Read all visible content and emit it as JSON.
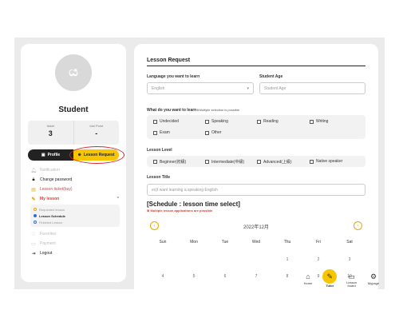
{
  "profile": {
    "avatar_text": "ය",
    "name": "Student",
    "stats": [
      {
        "label": "ticket",
        "value": "3"
      },
      {
        "label": "Idol Point",
        "value": "-"
      }
    ],
    "tabs": {
      "profile": "Profile",
      "lesson_request": "Lesson Request"
    }
  },
  "menu": {
    "notification": "Notification",
    "change_password": "Change password",
    "lesson_ticket": "Lesson ticket(buy)",
    "my_lesson": "My lesson",
    "sub": [
      "Requested lesson",
      "Lesson Schedule",
      "Finished Lesson"
    ],
    "favorites": "Favorites",
    "payment": "Payment",
    "logout": "Logout"
  },
  "form": {
    "title": "Lesson Request",
    "language_label": "Language you want to learn",
    "language_value": "English",
    "age_label": "Student Age",
    "age_placeholder": "Student Age",
    "learn_label": "What do you want to learn",
    "learn_note": "※Multiple selection is possible",
    "learn_options": [
      "Undecided",
      "Speaking",
      "Reading",
      "Writing",
      "Exam",
      "Other"
    ],
    "level_label": "Lesson Level",
    "level_options": [
      "Beginner(初級)",
      "Intermediate(中級)",
      "Advanced(上級)",
      "Native speaker"
    ],
    "lesson_title_label": "Lesson Title",
    "lesson_title_placeholder": "ex)I want learning a speaking English",
    "schedule_title": "[Schedule : lesson time select]",
    "schedule_note": "※ Multiple lesson applications are possible"
  },
  "calendar": {
    "month": "2022年12月",
    "weekdays": [
      "Sun",
      "Mon",
      "Tue",
      "Wed",
      "Thu",
      "Fri",
      "Sat"
    ],
    "row1": [
      "",
      "",
      "",
      "",
      "1",
      "2",
      "3"
    ],
    "row2": [
      "4",
      "5",
      "6",
      "7",
      "8",
      "9",
      "10"
    ]
  },
  "bottom_nav": {
    "home": "Home",
    "tutor": "Tutor",
    "lesson_board": "Lesson board",
    "mypage": "Mypage"
  },
  "colors": {
    "accent": "#f7c600",
    "alert": "#e23a2e",
    "dark": "#222222"
  }
}
